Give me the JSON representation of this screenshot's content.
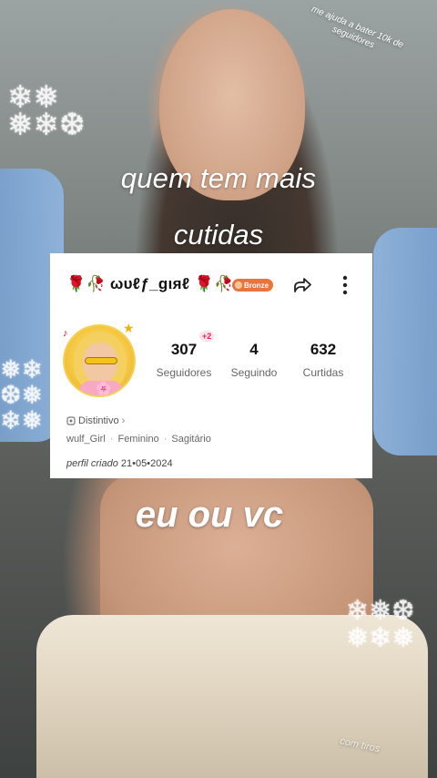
{
  "overlay": {
    "top_line": "quem tem mais",
    "second_line": "cutidas",
    "bottom_line": "eu ou vc",
    "corner_note": "me ajuda a bater 10k de seguidores",
    "watermark": "com tiros"
  },
  "profile": {
    "username": "🌹🥀 ωυℓƒ_gιяℓ 🌹🥀",
    "badge": "Bronze",
    "icons": {
      "share": "share-arrow-icon",
      "more": "more-vertical-icon",
      "badge": "bronze-badge-icon"
    },
    "stats": {
      "followers_count": "307",
      "followers_label": "Seguidores",
      "followers_delta": "+2",
      "following_count": "4",
      "following_label": "Seguindo",
      "likes_count": "632",
      "likes_label": "Curtidas"
    },
    "distintivo": "Distintivo",
    "details": {
      "handle": "wulf_Girl",
      "gender": "Feminino",
      "sign": "Sagitário"
    },
    "created_label": "perfil criado",
    "created_date": "21•05•2024"
  },
  "colors": {
    "badge_bg": "#e8763c",
    "delta_text": "#e0245e",
    "card_bg": "#ffffff"
  }
}
